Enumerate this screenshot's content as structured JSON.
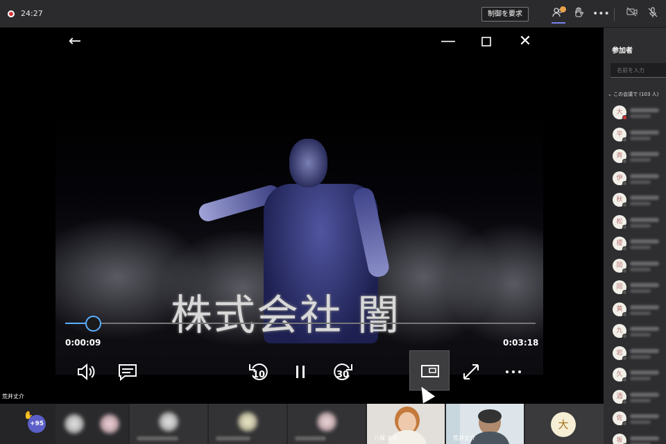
{
  "topbar": {
    "timer": "24:27",
    "request_control_label": "制御を要求",
    "icons": [
      "record-icon",
      "people-icon",
      "raise-hand-icon",
      "more-icon",
      "camera-off-icon",
      "mic-off-icon"
    ]
  },
  "player": {
    "caption": "株式会社 闇",
    "current_time": "0:00:09",
    "total_time": "0:03:18",
    "progress_fraction": 0.06,
    "skip_back": "10",
    "skip_forward": "30",
    "accent": "#5ab0ff"
  },
  "presenter_name": "荒井丈介",
  "participants_panel": {
    "title": "参加者",
    "search_placeholder": "名前を入力",
    "meeting_count": "この会議で (103 人)",
    "avatars": [
      {
        "initial": "大",
        "status": "red"
      },
      {
        "initial": "平",
        "status": "gray"
      },
      {
        "initial": "斉",
        "status": "gray"
      },
      {
        "initial": "伊",
        "status": "gray"
      },
      {
        "initial": "秋",
        "status": "gray"
      },
      {
        "initial": "松",
        "status": "gray"
      },
      {
        "initial": "榎",
        "status": "gray"
      },
      {
        "initial": "岡",
        "status": "gray"
      },
      {
        "initial": "岡",
        "status": "gray"
      },
      {
        "initial": "黄",
        "status": "gray"
      },
      {
        "initial": "九",
        "status": "gray"
      },
      {
        "initial": "岩",
        "status": "gray"
      },
      {
        "initial": "久",
        "status": "gray"
      },
      {
        "initial": "酒",
        "status": "gray"
      },
      {
        "initial": "佐",
        "status": "gray"
      },
      {
        "initial": "坂",
        "status": "gray"
      }
    ]
  },
  "bottom_strip": {
    "more_count": "+95",
    "cam_tiles": [
      {
        "label": "八塚 まや..."
      },
      {
        "label": "荒井丈介"
      }
    ],
    "last_avatar": "大"
  }
}
